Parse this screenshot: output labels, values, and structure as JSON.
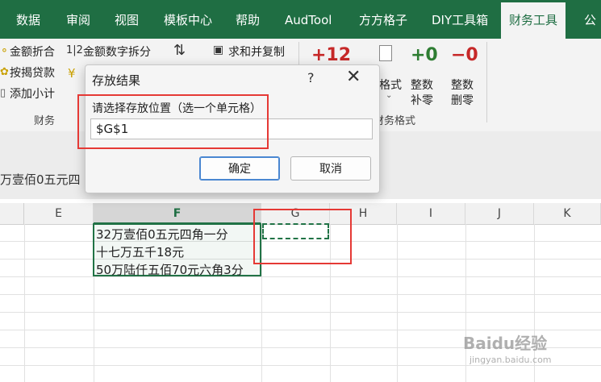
{
  "tabs": [
    "数据",
    "审阅",
    "视图",
    "模板中心",
    "帮助",
    "AudTool",
    "方方格子",
    "DIY工具箱",
    "财务工具",
    "公"
  ],
  "active_tab_index": 8,
  "ribbon": {
    "col1": [
      "金额折合",
      "按揭贷款",
      "添加小计"
    ],
    "col2_top": "金额数字拆分",
    "col2_prefix": "1|2",
    "col3_top": "求和并复制",
    "format_big": "+12",
    "format_label": "格式",
    "fill_zero_icon": "+0",
    "fill_zero_label1": "整数",
    "fill_zero_label2": "补零",
    "del_zero_icon": "−0",
    "del_zero_label1": "整数",
    "del_zero_label2": "删零",
    "group_finance": "财务",
    "group_finance_format": "财务格式"
  },
  "formula_bar_text": "万壹佰0五元四",
  "columns": [
    "E",
    "F",
    "G",
    "H",
    "I",
    "J",
    "K"
  ],
  "selected_column": "F",
  "cells": [
    "32万壹佰0五元四角一分",
    "十七万五千18元",
    "50万陆仟五佰70元六角3分"
  ],
  "dialog": {
    "title": "存放结果",
    "help": "?",
    "close": "✕",
    "label": "请选择存放位置（选一个单元格）",
    "input_value": "$G$1",
    "ok": "确定",
    "cancel": "取消"
  },
  "watermark": "Baidu经验",
  "watermark_url": "jingyan.baidu.com"
}
